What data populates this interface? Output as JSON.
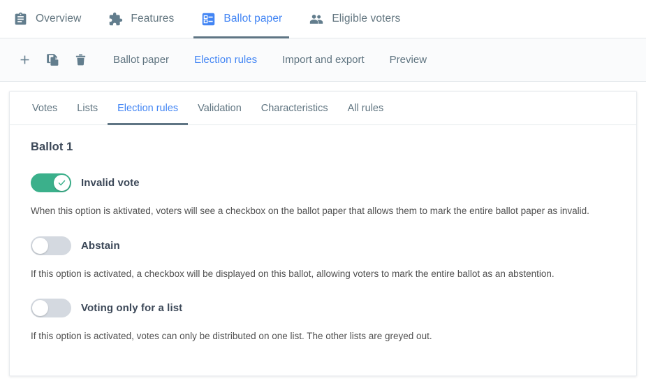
{
  "topnav": {
    "items": [
      {
        "label": "Overview",
        "icon": "clipboard-icon",
        "active": false
      },
      {
        "label": "Features",
        "icon": "puzzle-icon",
        "active": false
      },
      {
        "label": "Ballot paper",
        "icon": "ballot-form-icon",
        "active": true
      },
      {
        "label": "Eligible voters",
        "icon": "people-icon",
        "active": false
      }
    ]
  },
  "toolbar": {
    "icons": [
      {
        "name": "add-icon",
        "title": "Add"
      },
      {
        "name": "duplicate-icon",
        "title": "Duplicate"
      },
      {
        "name": "delete-icon",
        "title": "Delete"
      }
    ],
    "links": [
      {
        "label": "Ballot paper",
        "active": false
      },
      {
        "label": "Election rules",
        "active": true
      },
      {
        "label": "Import and export",
        "active": false
      },
      {
        "label": "Preview",
        "active": false
      }
    ]
  },
  "subtabs": [
    {
      "label": "Votes",
      "active": false
    },
    {
      "label": "Lists",
      "active": false
    },
    {
      "label": "Election rules",
      "active": true
    },
    {
      "label": "Validation",
      "active": false
    },
    {
      "label": "Characteristics",
      "active": false
    },
    {
      "label": "All rules",
      "active": false
    }
  ],
  "main": {
    "title": "Ballot 1",
    "rules": [
      {
        "label": "Invalid vote",
        "enabled": true,
        "description": "When this option is aktivated, voters will see a checkbox on the ballot paper that allows them to mark the entire ballot paper as invalid."
      },
      {
        "label": "Abstain",
        "enabled": false,
        "description": "If this option is activated, a checkbox will be displayed on this ballot, allowing voters to mark the entire ballot as an abstention."
      },
      {
        "label": "Voting only for a list",
        "enabled": false,
        "description": "If this option is activated, votes can only be distributed on one list. The other lists are greyed out."
      }
    ]
  },
  "colors": {
    "accent_blue": "#4285f4",
    "toggle_on_green": "#3bb08b",
    "toggle_off_grey": "#d4d9e0",
    "icon_slate": "#627d8d",
    "underline_slate": "#5f7584",
    "text_dark": "#3c4858"
  }
}
